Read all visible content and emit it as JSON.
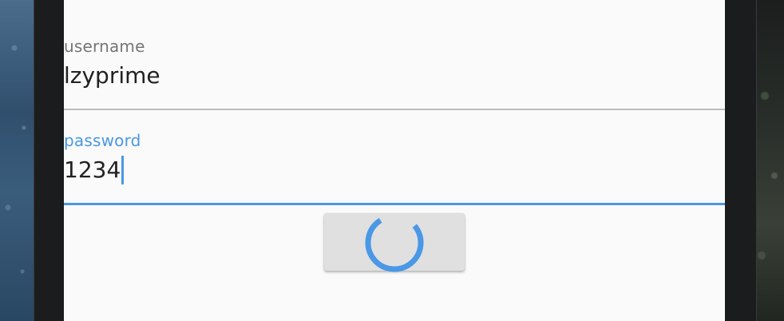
{
  "form": {
    "username": {
      "label": "username",
      "value": "lzyprime"
    },
    "password": {
      "label": "password",
      "value": "1234",
      "focused": true
    },
    "submit": {
      "state": "loading",
      "icon": "loading-spinner-icon"
    }
  },
  "colors": {
    "accent": "#4a98e6",
    "surface": "#fafafa",
    "button": "#e0e0e0",
    "label_inactive": "#757575",
    "underline_inactive": "#bdbdbd"
  }
}
